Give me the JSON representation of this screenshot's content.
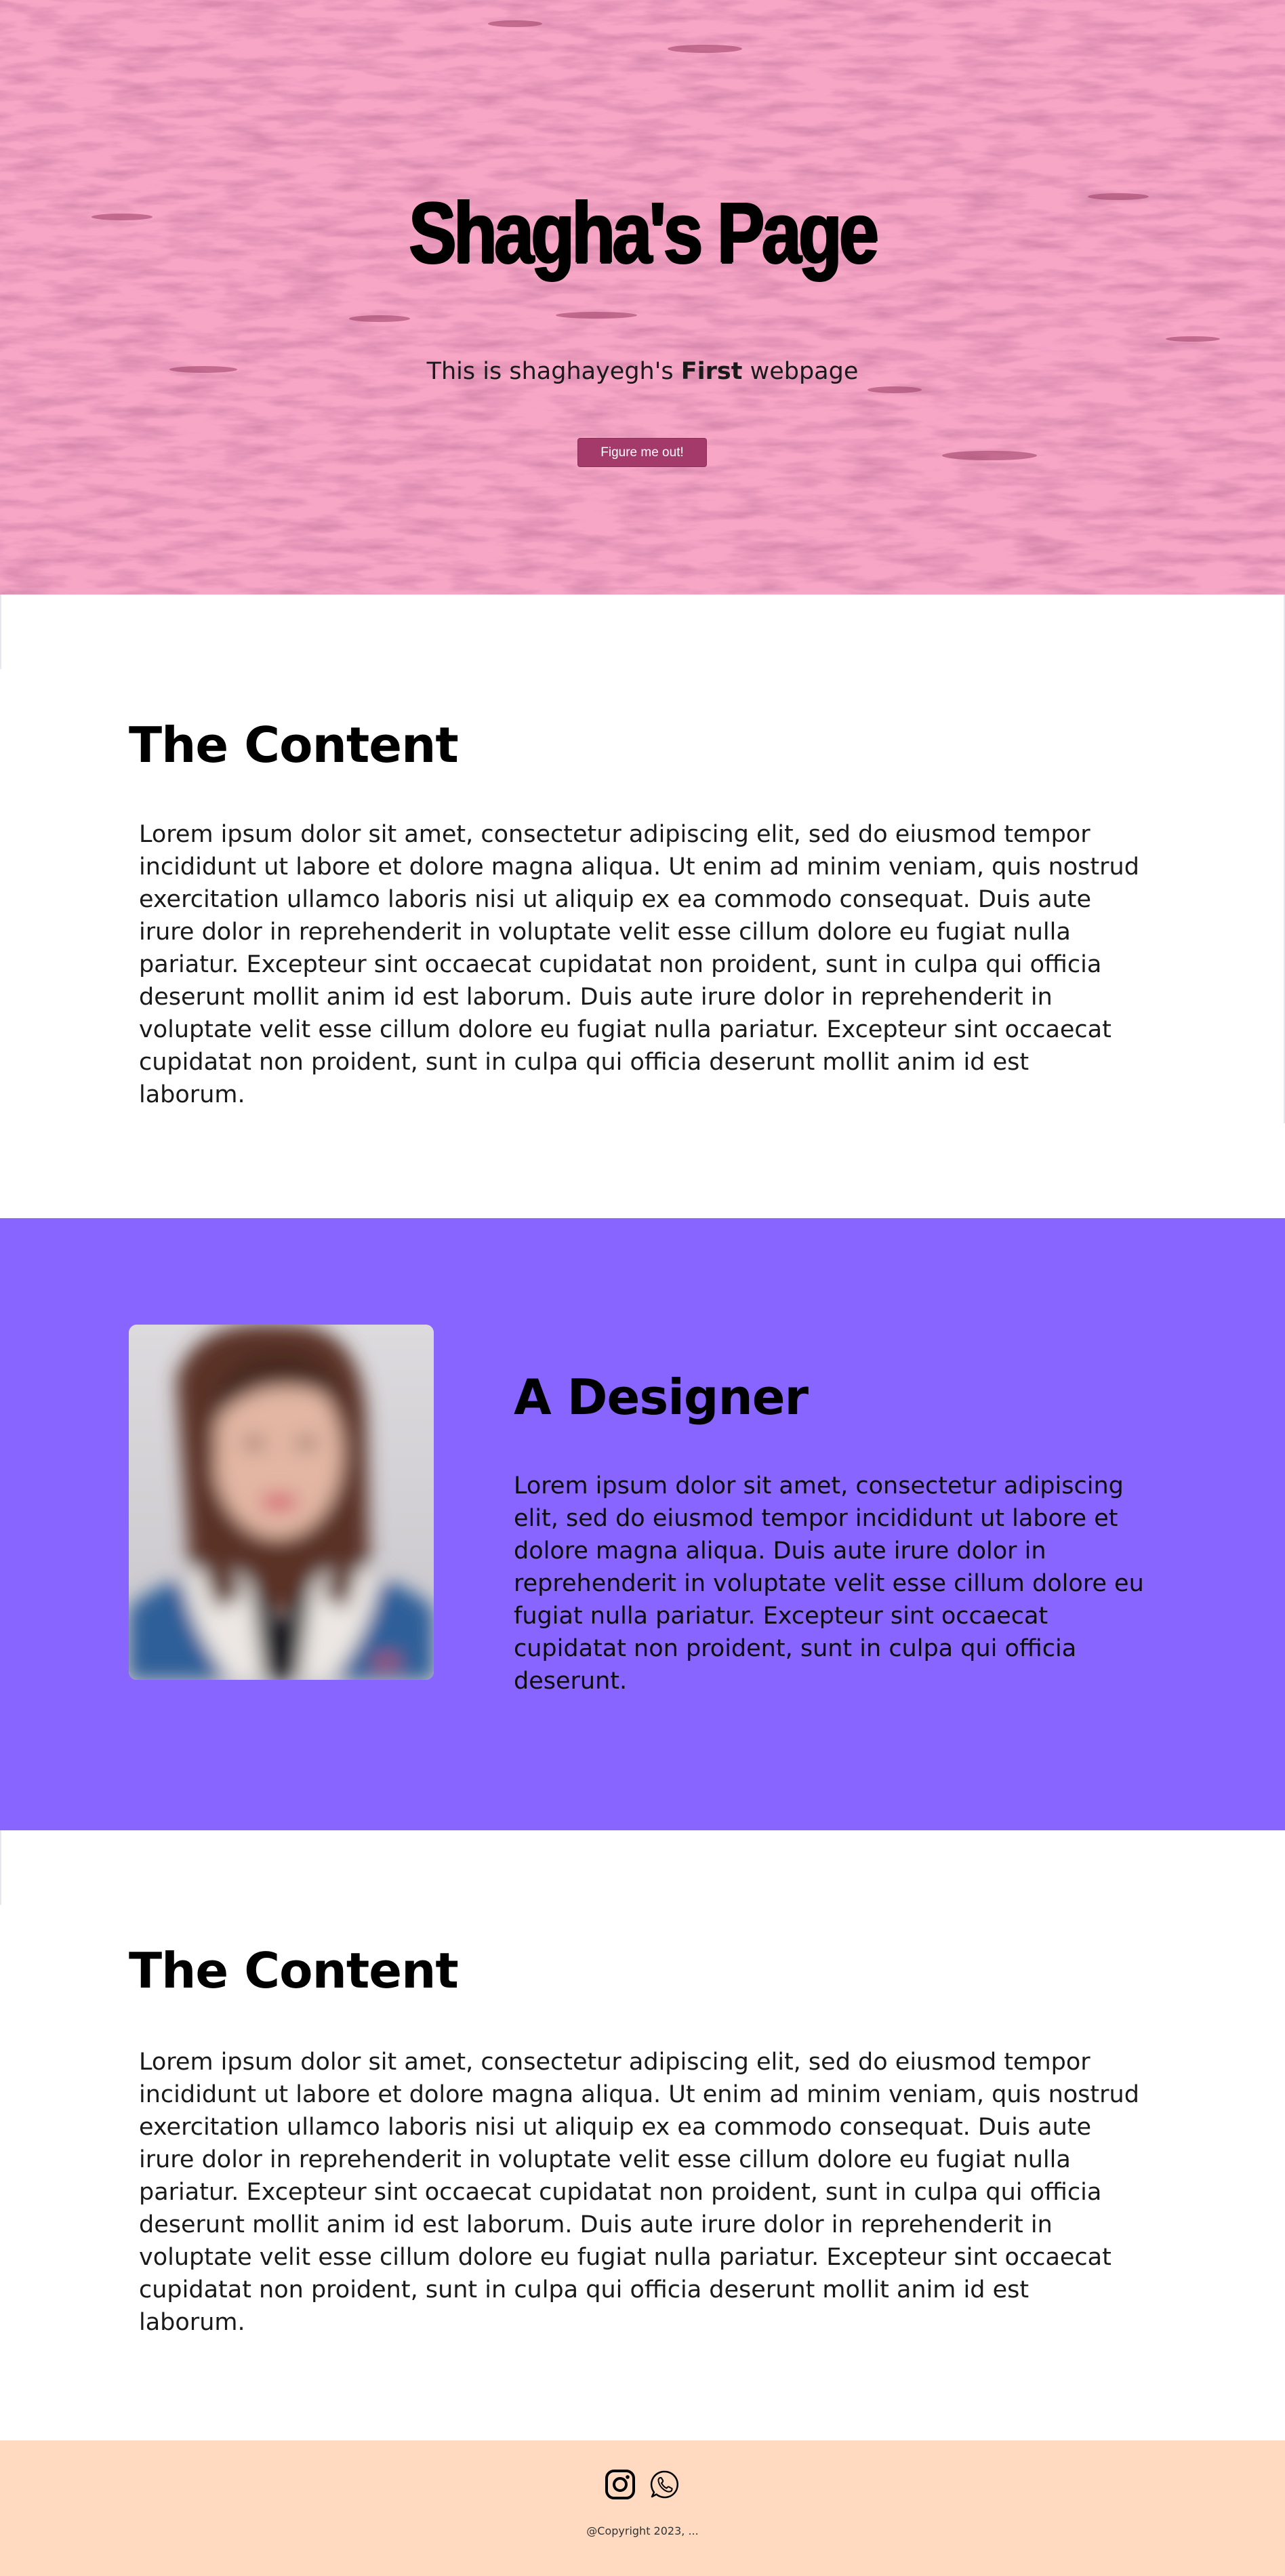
{
  "hero": {
    "title": "Shagha's Page",
    "subtitle_before": "This is shaghayegh's ",
    "subtitle_bold": "First",
    "subtitle_after": " webpage",
    "button_label": "Figure me out!",
    "background_color": "#f7a6c6",
    "button_color": "#a33a6a"
  },
  "content_sections": [
    {
      "title": "The Content",
      "text": "Lorem ipsum dolor sit amet, consectetur adipiscing elit, sed do eiusmod tempor incididunt ut labore et dolore magna aliqua. Ut enim ad minim veniam, quis nostrud exercitation ullamco laboris nisi ut aliquip ex ea commodo consequat. Duis aute irure dolor in reprehenderit in voluptate velit esse cillum dolore eu fugiat nulla pariatur. Excepteur sint occaecat cupidatat non proident, sunt in culpa qui officia deserunt mollit anim id est laborum. Duis aute irure dolor in reprehenderit in voluptate velit esse cillum dolore eu fugiat nulla pariatur. Excepteur sint occaecat cupidatat non proident, sunt in culpa qui officia deserunt mollit anim id est laborum."
    },
    {
      "title": "The Content",
      "text": "Lorem ipsum dolor sit amet, consectetur adipiscing elit, sed do eiusmod tempor incididunt ut labore et dolore magna aliqua. Ut enim ad minim veniam, quis nostrud exercitation ullamco laboris nisi ut aliquip ex ea commodo consequat. Duis aute irure dolor in reprehenderit in voluptate velit esse cillum dolore eu fugiat nulla pariatur. Excepteur sint occaecat cupidatat non proident, sunt in culpa qui officia deserunt mollit anim id est laborum. Duis aute irure dolor in reprehenderit in voluptate velit esse cillum dolore eu fugiat nulla pariatur. Excepteur sint occaecat cupidatat non proident, sunt in culpa qui officia deserunt mollit anim id est laborum."
    }
  ],
  "designer": {
    "title": "A Designer",
    "text": "Lorem ipsum dolor sit amet, consectetur adipiscing elit, sed do eiusmod tempor incididunt ut labore et dolore magna aliqua. Duis aute irure dolor in reprehenderit in voluptate velit esse cillum dolore eu fugiat nulla pariatur. Excepteur sint occaecat cupidatat non proident, sunt in culpa qui officia deserunt.",
    "background_color": "#8865ff",
    "photo_icon": "portrait-photo"
  },
  "footer": {
    "icons": [
      "instagram-icon",
      "whatsapp-icon"
    ],
    "copyright": "@Copyright 2023, ...",
    "background_color": "#ffdac0"
  }
}
